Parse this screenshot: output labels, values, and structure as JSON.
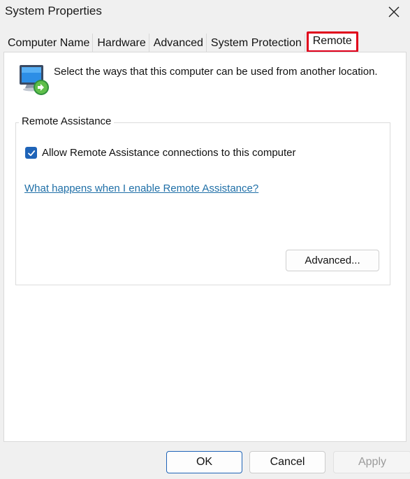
{
  "window": {
    "title": "System Properties"
  },
  "tabs": [
    {
      "label": "Computer Name"
    },
    {
      "label": "Hardware"
    },
    {
      "label": "Advanced"
    },
    {
      "label": "System Protection"
    },
    {
      "label": "Remote",
      "active": true
    }
  ],
  "intro_text": "Select the ways that this computer can be used from another location.",
  "remote_assistance": {
    "group_label": "Remote Assistance",
    "allow_label": "Allow Remote Assistance connections to this computer",
    "allow_checked": true,
    "help_link": "What happens when I enable Remote Assistance?",
    "advanced_label": "Advanced..."
  },
  "buttons": {
    "ok": "OK",
    "cancel": "Cancel",
    "apply": "Apply"
  },
  "colors": {
    "accent": "#1f64b8",
    "link": "#1f6fa7",
    "highlight": "#e0001b"
  }
}
